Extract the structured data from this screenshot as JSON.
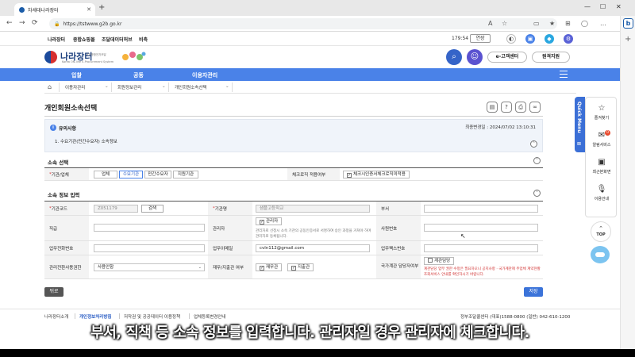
{
  "browser": {
    "tab_title": "차세대나라장터",
    "url": "https://tstwww.g2b.go.kr"
  },
  "utility": {
    "links": [
      "나라장터",
      "종합쇼핑몰",
      "조달데이터허브",
      "비축"
    ],
    "session_time": "179:54",
    "extend_label": "연장"
  },
  "header": {
    "logo_text": "나라장터",
    "logo_sub": "Korea ON-line E-Procurement System",
    "logo_sub2": "국가종합전자조달",
    "customer_center": "e-고객센터",
    "remote_support": "원격지원"
  },
  "mainnav": [
    "입찰",
    "공동",
    "이용자관리"
  ],
  "breadcrumb": [
    "이용자관리",
    "회원정보관리",
    "개인회원소속선택"
  ],
  "page": {
    "title": "개인회원소속선택"
  },
  "notice": {
    "title": "유의사항",
    "last_modified": "최종변경일 : 2024/07/02 13:10:31",
    "item": "1. 수요기관(민간수요자) 소속정보"
  },
  "affiliation": {
    "section_title": "소속 선택",
    "org_label": "기관/업체",
    "org_types": [
      "업체",
      "수요기관",
      "민간수요자",
      "지원기관"
    ],
    "active_type": "수요기관",
    "check_label": "체크로직 적용여부",
    "check_value": "체크시인증서체크로직미적용"
  },
  "info": {
    "section_title": "소속 정보 입력",
    "org_code_label": "기관코드",
    "org_code_value": "Z051179",
    "search_label": "검색",
    "org_name_label": "기관명",
    "org_name_value": "샘플고등학교",
    "dept_label": "부서",
    "position_label": "직급",
    "manager_label": "관리자",
    "manager_check": "관리자",
    "manager_note": "관리자로 선정시 소속 기관의 공동인증서로 서명하여 승인 과정을 거쳐야 하며 관리자로 등록됩니다.",
    "emp_no_label": "사원번호",
    "phone_label": "업무전화번호",
    "email_label": "업무이메일",
    "email_value": "cvln112@gmail.com",
    "fax_label": "업무팩스번호",
    "system_role_label": "관리전환사용권한",
    "system_role_value": "사용안함",
    "finance_label": "재무/지출관 여부",
    "finance_options": [
      "재무관",
      "지출관"
    ],
    "contract_label": "국가계관 담당자여부",
    "contract_check": "계관담당",
    "contract_note": "계관담당 업무 권한 수정은 필요하오니 공지사항 · 국가계관제 주업체 계약현황 조회서비스 안내를 확인하시기 바랍니다."
  },
  "buttons": {
    "back": "뒤로",
    "save": "저장"
  },
  "footer": {
    "links": [
      "나라장터소개",
      "개인정보처리방침",
      "저작권 및 공공데이터 이용정책",
      "업체등록변경안내"
    ],
    "contact": "정부조달콜센터 (대표)1588-0800 (일반) 042-610-1200"
  },
  "subtitle": "부서, 직책 등 소속 정보를 입력합니다. 관리자일 경우 관리자에 체크합니다.",
  "quickmenu": {
    "tab_label": "Quick Menu",
    "items": [
      "즐겨찾기",
      "알림서비스",
      "최근본화면",
      "이용안내"
    ],
    "badge": "0",
    "top_label": "TOP"
  }
}
